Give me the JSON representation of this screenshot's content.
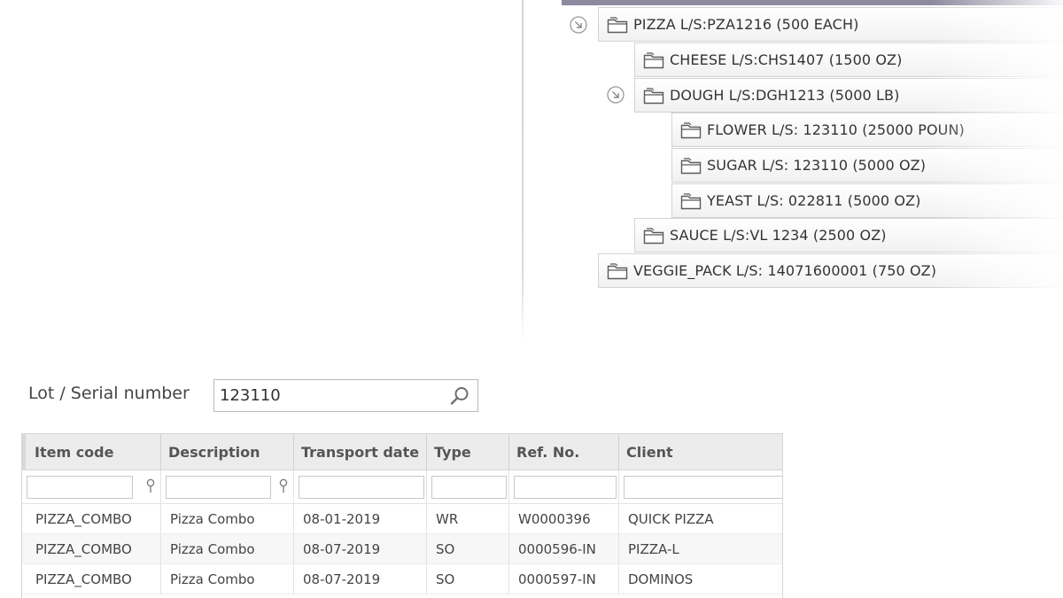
{
  "tree": {
    "nodes": [
      {
        "label": "PIZZA L/S:PZA1216 (500 EACH)",
        "expandable": true
      },
      {
        "label": "CHEESE L/S:CHS1407 (1500 OZ)",
        "expandable": false
      },
      {
        "label": "DOUGH L/S:DGH1213 (5000 LB)",
        "expandable": true
      },
      {
        "label": "FLOWER L/S: 123110 (25000 POUN)",
        "expandable": false
      },
      {
        "label": "SUGAR L/S: 123110 (5000 OZ)",
        "expandable": false
      },
      {
        "label": "YEAST L/S: 022811 (5000 OZ)",
        "expandable": false
      },
      {
        "label": "SAUCE L/S:VL 1234 (2500 OZ)",
        "expandable": false
      },
      {
        "label": "VEGGIE_PACK L/S: 14071600001 (750 OZ)",
        "expandable": false
      }
    ]
  },
  "search": {
    "label": "Lot / Serial number",
    "value": "123110"
  },
  "grid": {
    "columns": [
      "Item code",
      "Description",
      "Transport date",
      "Type",
      "Ref. No.",
      "Client"
    ],
    "rows": [
      [
        "PIZZA_COMBO",
        "Pizza Combo",
        "08-01-2019",
        "WR",
        "W0000396",
        "QUICK PIZZA"
      ],
      [
        "PIZZA_COMBO",
        "Pizza Combo",
        "08-07-2019",
        "SO",
        "0000596-IN",
        "PIZZA-L"
      ],
      [
        "PIZZA_COMBO",
        "Pizza Combo",
        "08-07-2019",
        "SO",
        "0000597-IN",
        "DOMINOS"
      ]
    ]
  },
  "colors": {
    "tree_topbar": "#8c8a9e",
    "header_bg": "#ececec",
    "border": "#d6d6d6"
  }
}
